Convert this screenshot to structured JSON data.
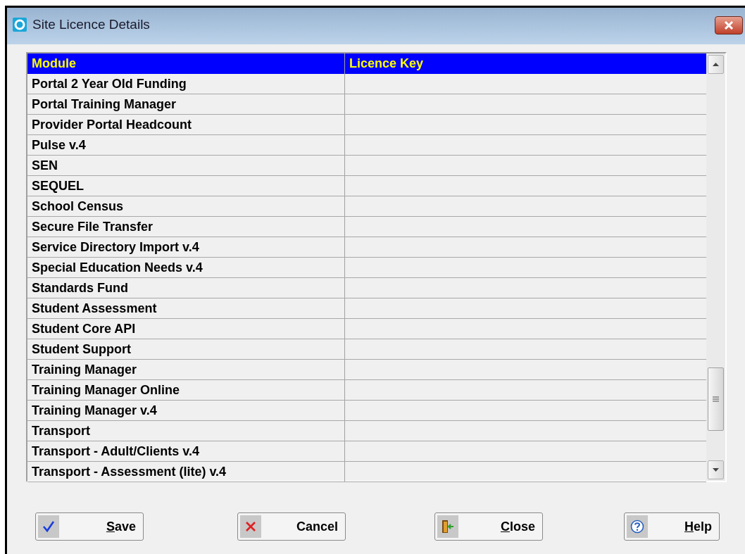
{
  "window": {
    "title": "Site Licence Details"
  },
  "table": {
    "columns": [
      "Module",
      "Licence Key"
    ],
    "rows": [
      {
        "module": "Portal 2 Year Old Funding"
      },
      {
        "module": "Portal Training Manager"
      },
      {
        "module": "Provider Portal Headcount"
      },
      {
        "module": "Pulse v.4"
      },
      {
        "module": "SEN"
      },
      {
        "module": "SEQUEL"
      },
      {
        "module": "School Census"
      },
      {
        "module": "Secure File Transfer"
      },
      {
        "module": "Service Directory Import v.4"
      },
      {
        "module": "Special Education Needs v.4"
      },
      {
        "module": "Standards Fund"
      },
      {
        "module": "Student Assessment"
      },
      {
        "module": "Student Core API"
      },
      {
        "module": "Student Support"
      },
      {
        "module": "Training Manager"
      },
      {
        "module": "Training Manager Online"
      },
      {
        "module": "Training Manager v.4"
      },
      {
        "module": "Transport"
      },
      {
        "module": "Transport - Adult/Clients v.4"
      },
      {
        "module": "Transport - Assessment (lite) v.4"
      }
    ]
  },
  "buttons": [
    {
      "kind": "save",
      "label": "Save",
      "underline_first": true
    },
    {
      "kind": "cancel",
      "label": "Cancel",
      "underline_first": false
    },
    {
      "kind": "close",
      "label": "Close",
      "underline_first": true
    },
    {
      "kind": "help",
      "label": "Help",
      "underline_first": true
    }
  ]
}
